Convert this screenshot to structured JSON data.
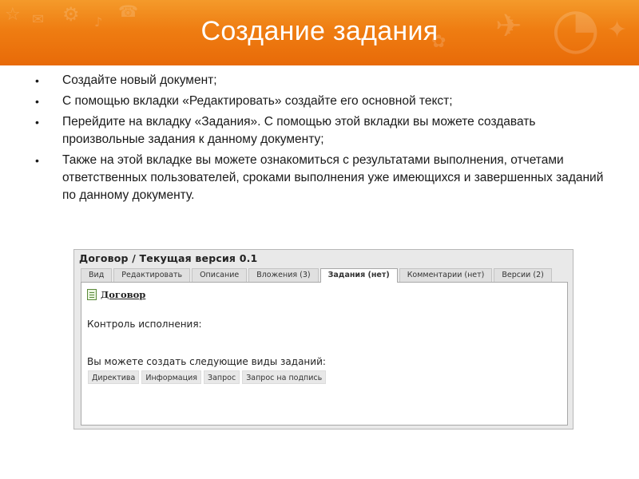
{
  "slide": {
    "title": "Создание задания",
    "bullets": [
      "Создайте новый документ;",
      "С помощью вкладки «Редактировать» создайте его основной текст;",
      "Перейдите на вкладку «Задания». С помощью этой вкладки вы можете создавать произвольные задания к данному документу;",
      "Также на этой вкладке вы можете ознакомиться с результатами выполнения, отчетами ответственных пользователей, сроками выполнения уже имеющихся и завершенных заданий по данному документу."
    ]
  },
  "screenshot": {
    "title": "Договор / Текущая версия 0.1",
    "tabs": [
      {
        "label": "Вид",
        "active": false
      },
      {
        "label": "Редактировать",
        "active": false
      },
      {
        "label": "Описание",
        "active": false
      },
      {
        "label": "Вложения (3)",
        "active": false
      },
      {
        "label": "Задания (нет)",
        "active": true
      },
      {
        "label": "Комментарии (нет)",
        "active": false
      },
      {
        "label": "Версии (2)",
        "active": false
      }
    ],
    "document_link": "Договор",
    "control_label": "Контроль исполнения:",
    "create_label": "Вы можете создать следующие виды заданий:",
    "task_types": [
      "Директива",
      "Информация",
      "Запрос",
      "Запрос на подпись"
    ]
  },
  "colors": {
    "header_orange": "#ef7d12",
    "title_text": "#ffffff"
  }
}
